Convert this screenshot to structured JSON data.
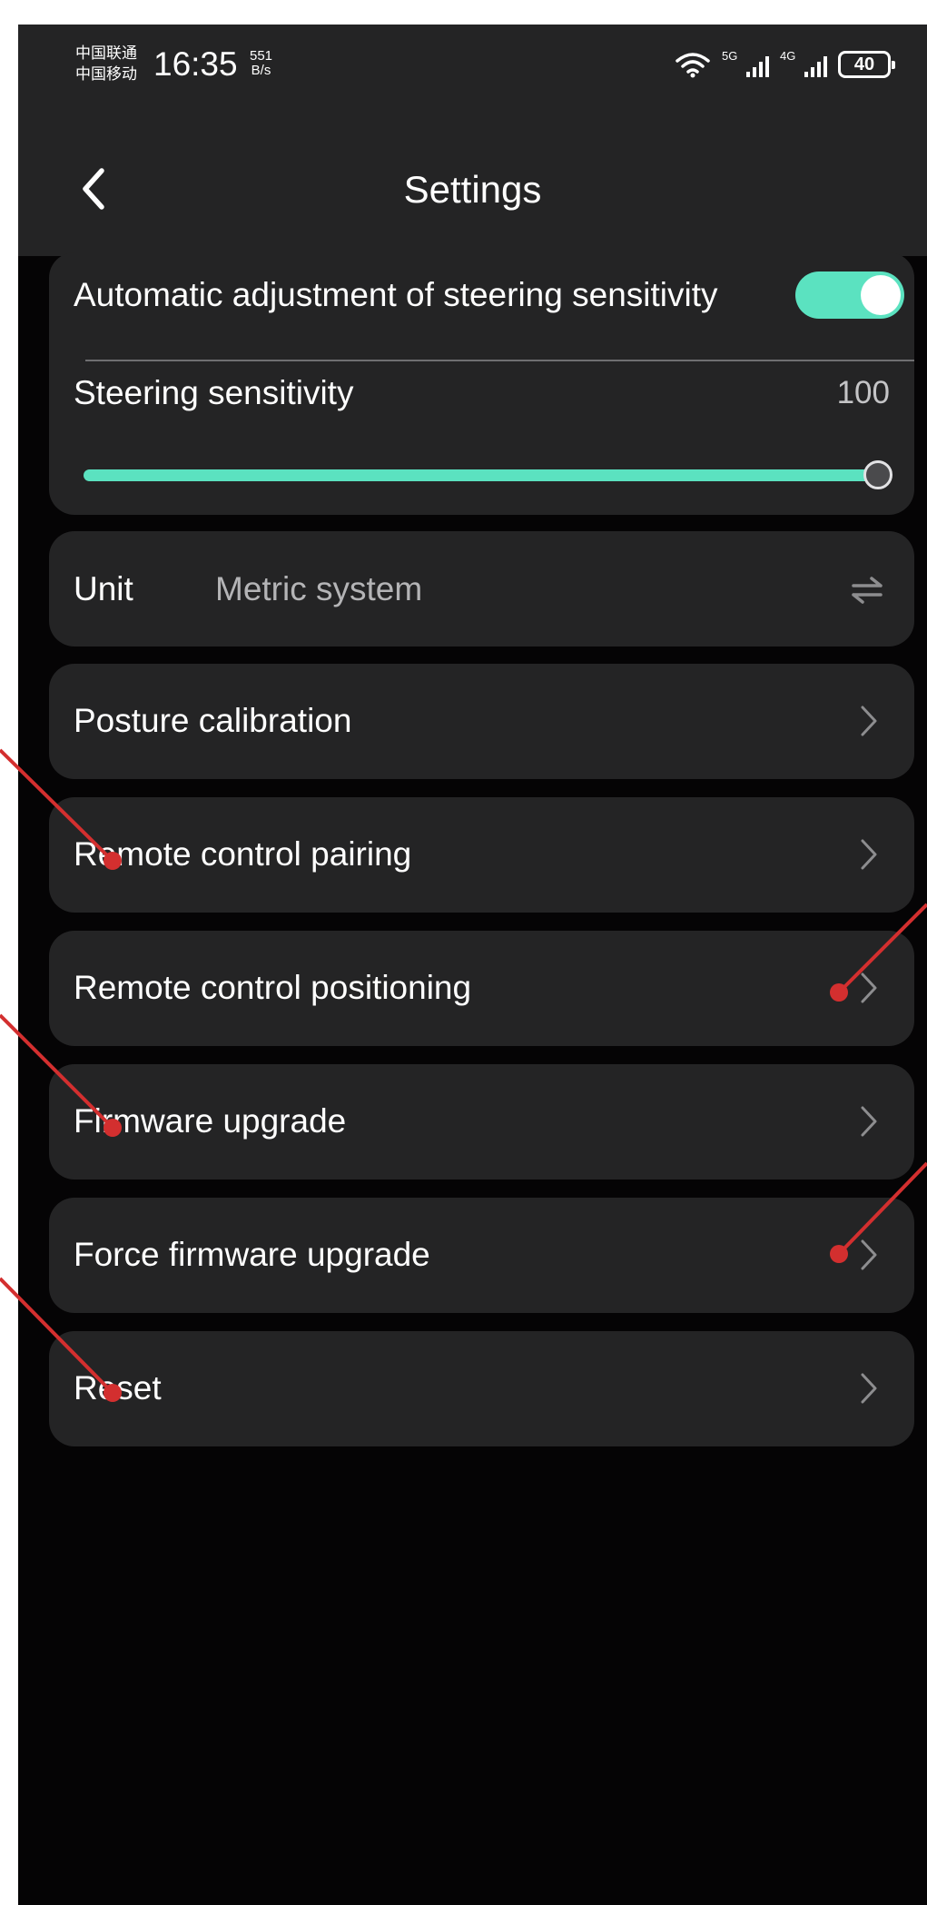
{
  "status_bar": {
    "carrier_1": "中国联通",
    "carrier_2": "中国移动",
    "time": "16:35",
    "net_speed_value": "551",
    "net_speed_unit": "B/s",
    "signal_1": "5G",
    "signal_2": "4G",
    "battery": "40"
  },
  "header": {
    "title": "Settings"
  },
  "steering": {
    "auto_label": "Automatic adjustment of steering sensitivity",
    "auto_enabled": true,
    "sensitivity_label": "Steering sensitivity",
    "sensitivity_value": "100",
    "slider_fraction": 1.0
  },
  "unit": {
    "label": "Unit",
    "value": "Metric system"
  },
  "menu": {
    "posture_calibration": "Posture calibration",
    "remote_control_pairing": "Remote control pairing",
    "remote_control_positioning": "Remote control positioning",
    "firmware_upgrade": "Firmware upgrade",
    "force_firmware_upgrade": "Force firmware upgrade",
    "reset": "Reset"
  },
  "colors": {
    "accent": "#5be2c0",
    "card": "#242425",
    "background": "#050405",
    "annotation": "#d32f2f"
  }
}
